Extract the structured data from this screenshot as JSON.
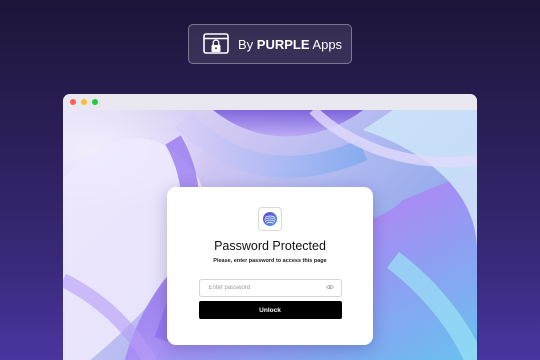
{
  "badge": {
    "icon": "lock-window-icon",
    "prefix": "By ",
    "brand": "PURPLE",
    "suffix": " Apps"
  },
  "browser": {
    "controls": {
      "close_color": "#ff5f57",
      "minimize_color": "#febc2e",
      "maximize_color": "#28c840"
    }
  },
  "card": {
    "logo_icon": "globe-fingerprint-icon",
    "title": "Password Protected",
    "subtitle": "Please, enter password to access this page",
    "password_placeholder": "Enter password",
    "password_value": "",
    "eye_icon": "eye-icon",
    "unlock_label": "Unlock"
  },
  "colors": {
    "background": "#2c1f5a",
    "button": "#000000",
    "card": "#ffffff"
  }
}
